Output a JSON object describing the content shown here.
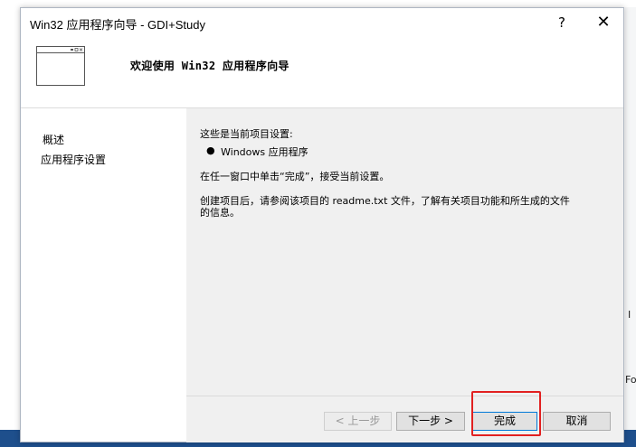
{
  "background": {
    "right_text_1": "I",
    "right_text_2": "Fo"
  },
  "dialog": {
    "title": "Win32 应用程序向导 - GDI+Study",
    "help_label": "?",
    "close_label": "✕"
  },
  "header": {
    "title": "欢迎使用 Win32 应用程序向导"
  },
  "sidebar": {
    "items": [
      {
        "label": "概述"
      },
      {
        "label": "应用程序设置"
      }
    ]
  },
  "content": {
    "intro": "这些是当前项目设置:",
    "bullet_symbol": "●",
    "bullet": "Windows 应用程序",
    "instruction": "在任一窗口中单击“完成”，接受当前设置。",
    "readme_line1": "创建项目后，请参阅该项目的 readme.txt 文件，了解有关项目功能和所生成的文件",
    "readme_line2": "的信息。"
  },
  "buttons": {
    "prev": "< 上一步",
    "next": "下一步 >",
    "finish": "完成",
    "cancel": "取消"
  },
  "colors": {
    "highlight": "#e12121",
    "content_bg": "#f0f0f0",
    "accent": "#0078d7"
  }
}
